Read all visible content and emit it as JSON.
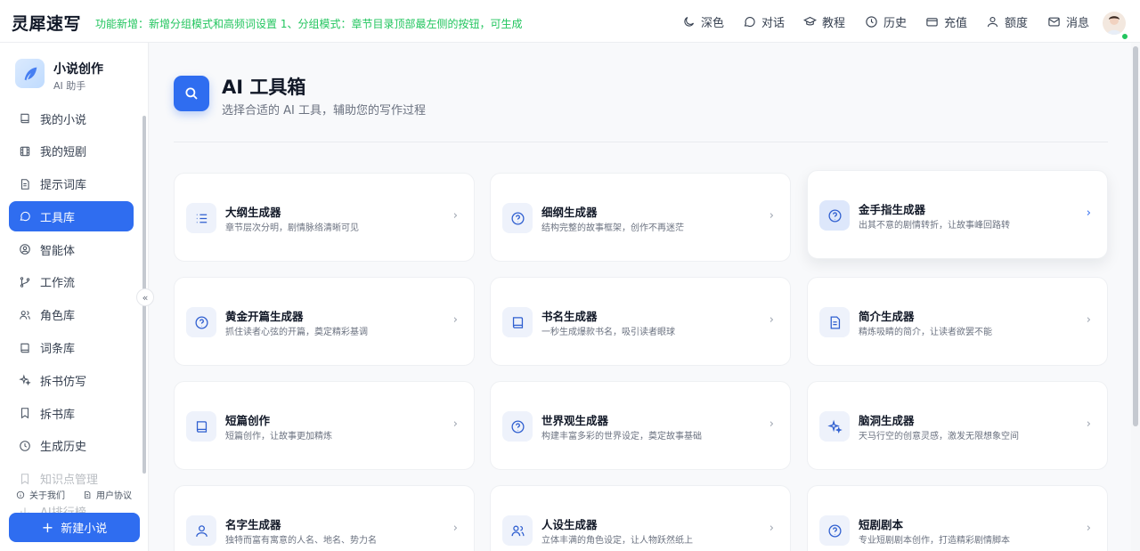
{
  "header": {
    "brand": "灵犀速写",
    "notice": "功能新增：新增分组模式和高频词设置 1、分组模式：章节目录顶部最左侧的按钮，可生成...",
    "nav": [
      {
        "label": "深色",
        "icon": "moon-icon"
      },
      {
        "label": "对话",
        "icon": "chat-icon"
      },
      {
        "label": "教程",
        "icon": "graduation-cap-icon"
      },
      {
        "label": "历史",
        "icon": "clock-icon"
      },
      {
        "label": "充值",
        "icon": "card-icon"
      },
      {
        "label": "额度",
        "icon": "user-icon"
      },
      {
        "label": "消息",
        "icon": "mail-icon"
      }
    ]
  },
  "sidebar": {
    "app_name": "小说创作",
    "app_sub": "AI 助手",
    "items": [
      {
        "label": "我的小说",
        "icon": "book-icon"
      },
      {
        "label": "我的短剧",
        "icon": "film-icon"
      },
      {
        "label": "提示词库",
        "icon": "document-icon"
      },
      {
        "label": "工具库",
        "icon": "chat-bubble-icon",
        "active": true
      },
      {
        "label": "智能体",
        "icon": "agent-icon"
      },
      {
        "label": "工作流",
        "icon": "git-branch-icon"
      },
      {
        "label": "角色库",
        "icon": "users-icon"
      },
      {
        "label": "词条库",
        "icon": "book-icon"
      },
      {
        "label": "拆书仿写",
        "icon": "sparkles-icon"
      },
      {
        "label": "拆书库",
        "icon": "bookmark-icon"
      },
      {
        "label": "生成历史",
        "icon": "clock-icon"
      },
      {
        "label": "知识点管理",
        "icon": "bookmark-icon"
      },
      {
        "label": "AI排行榜",
        "icon": "chart-icon"
      }
    ],
    "footer": {
      "about": "关于我们",
      "agreement": "用户协议"
    },
    "new_button": "新建小说"
  },
  "main": {
    "title": "AI 工具箱",
    "subtitle": "选择合适的 AI 工具，辅助您的写作过程",
    "tools": [
      {
        "title": "大纲生成器",
        "desc": "章节层次分明，剧情脉络清晰可见",
        "icon": "list-icon"
      },
      {
        "title": "细纲生成器",
        "desc": "结构完整的故事框架，创作不再迷茫",
        "icon": "question-circle-icon"
      },
      {
        "title": "金手指生成器",
        "desc": "出其不意的剧情转折，让故事峰回路转",
        "icon": "question-circle-icon"
      },
      {
        "title": "黄金开篇生成器",
        "desc": "抓住读者心弦的开篇，奠定精彩基调",
        "icon": "question-circle-icon"
      },
      {
        "title": "书名生成器",
        "desc": "一秒生成爆款书名，吸引读者眼球",
        "icon": "book-icon"
      },
      {
        "title": "简介生成器",
        "desc": "精炼吸睛的简介，让读者欲罢不能",
        "icon": "file-text-icon"
      },
      {
        "title": "短篇创作",
        "desc": "短篇创作，让故事更加精炼",
        "icon": "book-icon"
      },
      {
        "title": "世界观生成器",
        "desc": "构建丰富多彩的世界设定，奠定故事基础",
        "icon": "question-circle-icon"
      },
      {
        "title": "脑洞生成器",
        "desc": "天马行空的创意灵感，激发无限想象空间",
        "icon": "sparkles-icon"
      },
      {
        "title": "名字生成器",
        "desc": "独特而富有寓意的人名、地名、势力名",
        "icon": "user-icon"
      },
      {
        "title": "人设生成器",
        "desc": "立体丰满的角色设定，让人物跃然纸上",
        "icon": "users-icon"
      },
      {
        "title": "短剧剧本",
        "desc": "专业短剧剧本创作，打造精彩剧情脚本",
        "icon": "question-circle-icon"
      }
    ],
    "arrow": "›"
  },
  "colors": {
    "accent": "#2f6df0",
    "notice": "#22c55e"
  }
}
